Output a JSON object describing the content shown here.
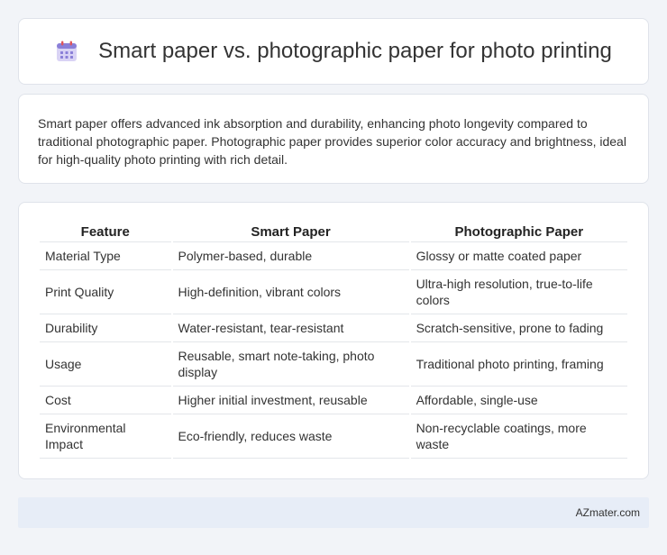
{
  "header": {
    "title": "Smart paper vs. photographic paper for photo printing",
    "icon": "calendar-icon"
  },
  "summary": {
    "text": "Smart paper offers advanced ink absorption and durability, enhancing photo longevity compared to traditional photographic paper. Photographic paper provides superior color accuracy and brightness, ideal for high-quality photo printing with rich detail."
  },
  "table": {
    "headers": [
      "Feature",
      "Smart Paper",
      "Photographic Paper"
    ],
    "rows": [
      [
        "Material Type",
        "Polymer-based, durable",
        "Glossy or matte coated paper"
      ],
      [
        "Print Quality",
        "High-definition, vibrant colors",
        "Ultra-high resolution, true-to-life colors"
      ],
      [
        "Durability",
        "Water-resistant, tear-resistant",
        "Scratch-sensitive, prone to fading"
      ],
      [
        "Usage",
        "Reusable, smart note-taking, photo display",
        "Traditional photo printing, framing"
      ],
      [
        "Cost",
        "Higher initial investment, reusable",
        "Affordable, single-use"
      ],
      [
        "Environmental Impact",
        "Eco-friendly, reduces waste",
        "Non-recyclable coatings, more waste"
      ]
    ]
  },
  "footer": {
    "brand": "AZmater.com"
  },
  "colors": {
    "icon_purple": "#8a7fd8",
    "icon_red": "#e0555a",
    "background": "#f2f4f8",
    "footer_bg": "#e7edf7"
  }
}
